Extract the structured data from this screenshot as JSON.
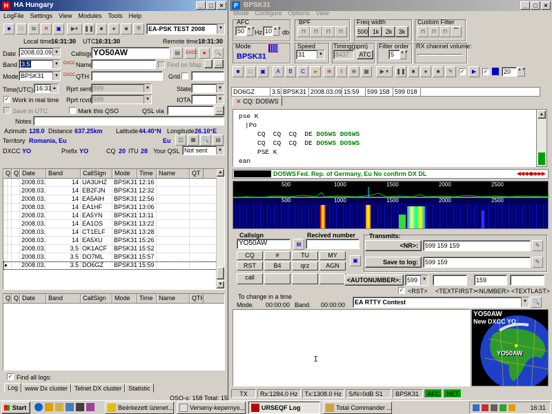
{
  "left_window": {
    "title": "HA Hungary",
    "menu": [
      "LogFile",
      "Settings",
      "View",
      "Modules",
      "Tools",
      "Help"
    ],
    "contest": "EA-PSK TEST 2008",
    "local_time_label": "Local time",
    "local_time": "16:31:30",
    "utc_label": "UTC",
    "utc_time": "16:31:30",
    "remote_time_label": "Remote time",
    "remote_time": "18:31:30"
  },
  "qso_form": {
    "date_label": "Date",
    "date": "2008.03.09.",
    "callsign_label": "Callsign",
    "callsign": "YO50AW",
    "band_label": "Band",
    "band": "3.5",
    "name_label": "Name",
    "name": "",
    "find_on_map": "Find on Map",
    "mode_label": "Mode",
    "mode": "BPSK31",
    "qth_label": "QTH",
    "qth": "",
    "grid_label": "Grid",
    "time_label": "Time(UTC)",
    "time": "16:31",
    "rpt_sent_label": "Rprt sent",
    "rpt_sent": "599",
    "state_label": "State",
    "work_realtime": "Work in real time",
    "rpt_rcvd_label": "Rprt rcvd",
    "rpt_rcvd": "599",
    "iota_label": "IOTA",
    "save_utc": "Save in UTC",
    "mark_qso": "Mark this QSO",
    "qsl_via_label": "QSL via",
    "notes_label": "Notes",
    "azimuth_label": "Azimuth",
    "azimuth": "128.0",
    "distance_label": "Distance",
    "distance": "637.25km",
    "latitude_label": "Latitude",
    "latitude": "44.40°N",
    "longitude_label": "Longitude",
    "longitude": "26.10°E",
    "territory_label": "Territory",
    "territory": "Romania, Eu",
    "continent": "Eu",
    "dxcc_label": "DXCC",
    "dxcc": "YO",
    "prefix_label": "Prefix",
    "prefix": "YO",
    "cq_label": "CQ",
    "cq": "20",
    "itu_label": "ITU",
    "itu": "28",
    "your_qsl_label": "Your QSL",
    "your_qsl": "Not sent"
  },
  "log_grid": {
    "columns": [
      "Q..",
      "Q..",
      "Date",
      "Band",
      "CallSign",
      "Mode",
      "Time",
      "Name",
      "QT"
    ],
    "rows": [
      [
        "",
        "",
        "2008.03.0",
        "14",
        "UA3UHZ",
        "BPSK31",
        "12:16",
        ""
      ],
      [
        "",
        "",
        "2008.03.0",
        "14",
        "EB2FJN",
        "BPSK31",
        "12:32",
        ""
      ],
      [
        "",
        "",
        "2008.03.0",
        "14",
        "EA5AIH",
        "BPSK31",
        "12:56",
        ""
      ],
      [
        "",
        "",
        "2008.03.0",
        "14",
        "EA1HF",
        "BPSK31",
        "13:06",
        ""
      ],
      [
        "",
        "",
        "2008.03.0",
        "14",
        "EA5YN",
        "BPSK31",
        "13:11",
        ""
      ],
      [
        "",
        "",
        "2008.03.0",
        "14",
        "EA1OS",
        "BPSK31",
        "13:22",
        ""
      ],
      [
        "",
        "",
        "2008.03.0",
        "14",
        "CT1ELF",
        "BPSK31",
        "13:28",
        ""
      ],
      [
        "",
        "",
        "2008.03.0",
        "14",
        "EA5XU",
        "BPSK31",
        "15:26",
        ""
      ],
      [
        "",
        "",
        "2008.03.0",
        "3.5",
        "OK1ACF",
        "BPSK31",
        "15:52",
        ""
      ],
      [
        "",
        "",
        "2008.03.0",
        "3.5",
        "DO7ML",
        "BPSK31",
        "15:57",
        ""
      ],
      [
        "",
        "",
        "2008.03.0",
        "3.5",
        "DO6GZ",
        "BPSK31",
        "15:59",
        ""
      ]
    ]
  },
  "dx_grid": {
    "columns": [
      "Q..",
      "Q..",
      "Date",
      "Band",
      "CallSign",
      "Mode",
      "Time",
      "Name",
      "QTH"
    ]
  },
  "left_bottom": {
    "find_all_logs": "Find all logs:",
    "tabs": [
      "Log",
      "www Dx cluster",
      "Telnet DX cluster",
      "Statistic"
    ],
    "status": "QSO-s: 158  Total: 158"
  },
  "right_window": {
    "title": "BPSK31",
    "menu": [
      "Mode",
      "Configure",
      "Options",
      "View"
    ],
    "afc_label": "AFC",
    "afc_value": "50",
    "afc_unit": "Hz",
    "afc2_value": "10",
    "afc2_unit": "db",
    "bpf_label": "BPF",
    "freq_width_label": "Freq width",
    "freq_width_opts": [
      "500",
      "1k",
      "2k",
      "3k"
    ],
    "custom_filter_label": "Custom Filter",
    "mode_label": "Mode",
    "mode_value": "BPSK31",
    "speed_label": "Speed",
    "speed_value": "31",
    "timing_label": "Timing(ppm)",
    "timing_value": "8437",
    "atc": "ATC",
    "filter_order_label": "Filter order",
    "filter_order_value": "5",
    "rx_volume_label": "RX channel volume:",
    "tx_count": "20"
  },
  "rx_header": {
    "fields": [
      "DO6GZ",
      "3.5",
      "BPSK31",
      "2008.03.09.",
      "15:59",
      "599 158",
      "599 018"
    ],
    "tab_label": "CQ: DO5WS"
  },
  "rx_text": {
    "lines": [
      {
        "indent": 0,
        "text": "pse K",
        "green": ""
      },
      {
        "indent": 1,
        "text": "|Po",
        "green": ""
      },
      {
        "indent": 3,
        "text": "CQ  CQ  CQ  DE ",
        "green": "DO5WS DO5WS"
      },
      {
        "indent": 3,
        "text": "CQ  CQ  CQ  DE ",
        "green": "DO5WS DO5WS"
      },
      {
        "indent": 3,
        "text": "PSE K",
        "green": ""
      },
      {
        "indent": 0,
        "text": "ean",
        "green": ""
      }
    ]
  },
  "info_bar": {
    "callsign": "DO5WS",
    "info": "Fed. Rep. of Germany, Eu  No confirm DX  DL"
  },
  "spectrum": {
    "ticks": [
      "500",
      "1000",
      "1500",
      "2000",
      "2500"
    ],
    "waterfall_ticks": [
      "500",
      "1000",
      "1500",
      "2000",
      "2500"
    ]
  },
  "qso_panel": {
    "callsign_label": "Callsign",
    "callsign": "YO50AW",
    "received_label": "Recived number",
    "received": "",
    "macros": [
      "CQ",
      "#",
      "TU",
      "MY",
      "RST",
      "B4",
      "qrz",
      "AGN",
      "call",
      "",
      "",
      ""
    ],
    "transmits_label": "Transmits:",
    "nr_label": "<NR>:",
    "nr_value": "599 159 159",
    "save_log_label": "Save to log:",
    "save_log_value": "599 159",
    "autonumber_label": "<AUTONUMBER>:",
    "autonumber_value": "599",
    "number_value": "159",
    "rst_label": "<RST>",
    "textfirst": "<TEXTFIRST>",
    "number_tag": "<NUMBER>",
    "textlast": "<TEXTLAST>",
    "change_time_label": "To change in a time",
    "mode_time_label": "Mode.",
    "mode_time": "00:00:00",
    "band_time_label": "Band.",
    "band_time": "00:00:00",
    "contest": "EA RTTY Contest"
  },
  "map": {
    "call": "YO50AW",
    "new_dxcc": "New DXCC YO",
    "label": "YO50AW"
  },
  "status_bar": {
    "tx": "TX",
    "rx_freq": "Rx:1284.0 Hz",
    "tx_freq": "Tx:1308.0 Hz",
    "sn": "S/N=0dB S1",
    "mode": "BPSK31",
    "afc": "AFC",
    "net": "NET"
  },
  "taskbar": {
    "start": "Start",
    "tasks": [
      "Beérkezett üzenet...",
      "Verseny-kepernyo...",
      "URSEQF Log",
      "Total Commander ..."
    ],
    "clock": "16:31"
  },
  "colors": {
    "title_active": "#0a246a",
    "callsign_green": "#008000",
    "accent_blue": "#0000c0",
    "info_green": "#00ff00"
  }
}
